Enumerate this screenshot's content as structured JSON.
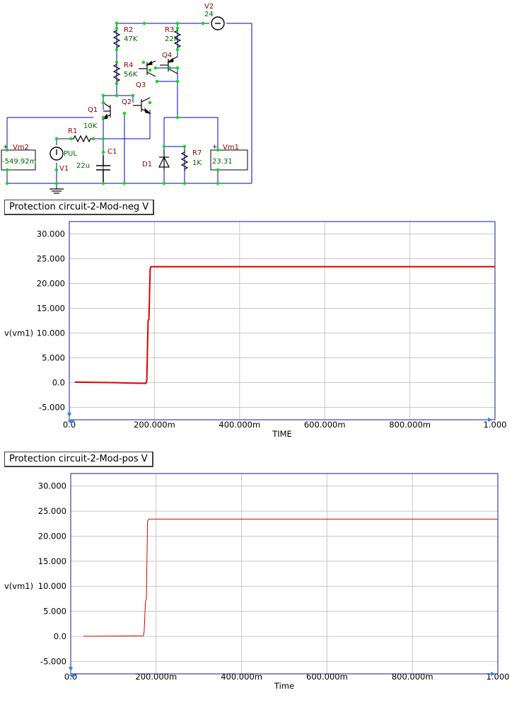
{
  "schematic": {
    "components": {
      "V2": {
        "name": "V2",
        "value": "24"
      },
      "R2": {
        "name": "R2",
        "value": "47K"
      },
      "R3": {
        "name": "R3",
        "value": "22K"
      },
      "Q4": {
        "name": "Q4"
      },
      "R4": {
        "name": "R4",
        "value": "56K"
      },
      "Q3": {
        "name": "Q3"
      },
      "Q1": {
        "name": "Q1"
      },
      "Q2": {
        "name": "Q2"
      },
      "R1": {
        "name": "R1",
        "value": "10K"
      },
      "V1": {
        "name": "V1",
        "value": "PUL"
      },
      "C1": {
        "name": "C1",
        "value": "22u"
      },
      "D1": {
        "name": "D1"
      },
      "R7": {
        "name": "R7",
        "value": "1K"
      },
      "Vm1": {
        "name": "Vm1",
        "reading": "23.31"
      },
      "Vm2": {
        "name": "Vm2",
        "reading": "-549.92m"
      }
    },
    "colors": {
      "wire": "#0000cc",
      "node": "#00dd00",
      "label": "#8b0000",
      "value": "#006400"
    }
  },
  "chart_data": [
    {
      "type": "line",
      "title": "Protection circuit-2-Mod-neg V",
      "xlabel": "TIME",
      "ylabel": "v(vm1)",
      "xlim": [
        0,
        1.0
      ],
      "ylim": [
        -7.5,
        32.5
      ],
      "xticks": [
        0,
        0.2,
        0.4,
        0.6,
        0.8,
        1.0
      ],
      "xtick_labels": [
        "0.0",
        "200.000m",
        "400.000m",
        "600.000m",
        "800.000m",
        "1.000"
      ],
      "yticks": [
        -5,
        0,
        5,
        10,
        15,
        20,
        25,
        30
      ],
      "ytick_labels": [
        "-5.000",
        "0.0",
        "5.000",
        "10.000",
        "15.000",
        "20.000",
        "25.000",
        "30.000"
      ],
      "grid": true,
      "series": [
        {
          "color": "#dd0000",
          "line_width": 2,
          "x": [
            0.013,
            0.05,
            0.1,
            0.15,
            0.18,
            0.182,
            0.185,
            0.187,
            0.19,
            0.192,
            1.0
          ],
          "y": [
            0.1,
            0.05,
            0.0,
            -0.1,
            -0.15,
            0.5,
            12.5,
            12.8,
            23.0,
            23.4,
            23.4
          ]
        }
      ]
    },
    {
      "type": "line",
      "title": "Protection circuit-2-Mod-pos V",
      "xlabel": "Time",
      "ylabel": "v(vm1)",
      "xlim": [
        0,
        1.0
      ],
      "ylim": [
        -7.5,
        32.5
      ],
      "xticks": [
        0,
        0.2,
        0.4,
        0.6,
        0.8,
        1.0
      ],
      "xtick_labels": [
        "0.0",
        "200.000m",
        "400.000m",
        "600.000m",
        "800.000m",
        "1.000"
      ],
      "yticks": [
        -5,
        0,
        5,
        10,
        15,
        20,
        25,
        30
      ],
      "ytick_labels": [
        "-5.000",
        "0.0",
        "5.000",
        "10.000",
        "15.000",
        "20.000",
        "25.000",
        "30.000"
      ],
      "grid": true,
      "series": [
        {
          "color": "#dd0000",
          "line_width": 1,
          "x": [
            0.03,
            0.1,
            0.17,
            0.172,
            0.175,
            0.177,
            0.18,
            0.183,
            1.0
          ],
          "y": [
            0.0,
            0.05,
            0.1,
            1.0,
            7.0,
            7.3,
            23.0,
            23.4,
            23.4
          ]
        }
      ]
    }
  ]
}
